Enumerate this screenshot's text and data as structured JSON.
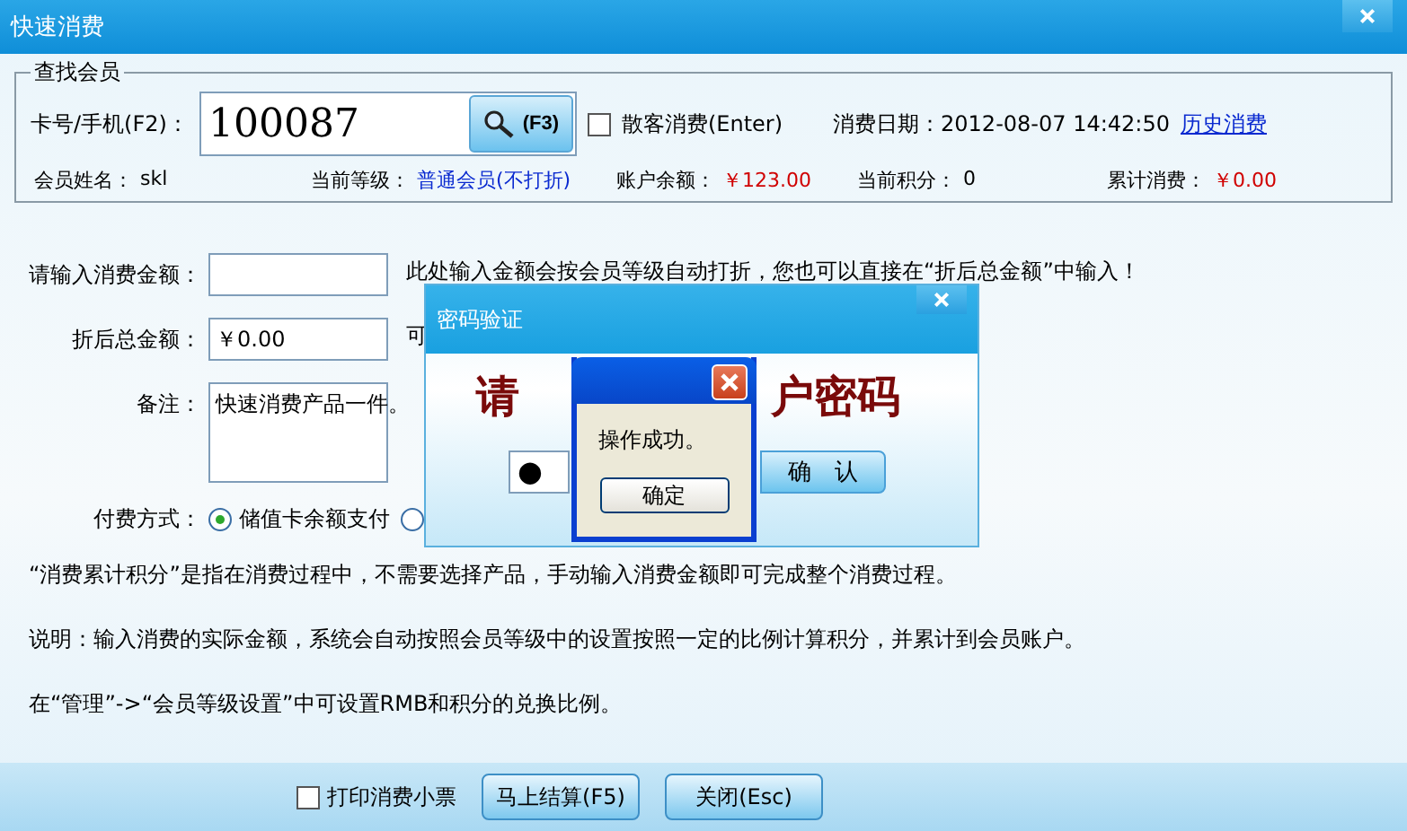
{
  "window": {
    "title": "快速消费"
  },
  "member_search": {
    "legend": "查找会员",
    "card_label": "卡号/手机(F2)：",
    "card_value": "100087",
    "search_button": "(F3)",
    "walk_in": {
      "label": "散客消费(Enter)",
      "checked": false
    },
    "date_label": "消费日期：",
    "date_value": "2012-08-07 14:42:50",
    "history_link": "历史消费",
    "info": [
      {
        "label": "会员姓名：",
        "value": "skl",
        "kind": "plain"
      },
      {
        "label": "当前等级：",
        "value": "普通会员(不打折)",
        "kind": "link"
      },
      {
        "label": "账户余额：",
        "value": "￥123.00",
        "kind": "money"
      },
      {
        "label": "当前积分：",
        "value": "0",
        "kind": "plain"
      },
      {
        "label": "累计消费：",
        "value": "￥0.00",
        "kind": "money"
      }
    ]
  },
  "form": {
    "amount": {
      "label": "请输入消费金额：",
      "hint": "此处输入金额会按会员等级自动打折，您也可以直接在“折后总金额”中输入！"
    },
    "total": {
      "label": "折后总金额：",
      "value": "￥0.00",
      "hint": "可"
    },
    "remark": {
      "label": "备注：",
      "value": "快速消费产品一件。"
    },
    "payment": {
      "label": "付费方式：",
      "options": [
        {
          "label": "储值卡余额支付",
          "selected": true
        },
        {
          "selected": false
        }
      ]
    }
  },
  "notes": [
    "“消费累计积分”是指在消费过程中，不需要选择产品，手动输入消费金额即可完成整个消费过程。",
    "说明：输入消费的实际金额，系统会自动按照会员等级中的设置按照一定的比例计算积分，并累计到会员账户。",
    "在“管理”->“会员等级设置”中可设置RMB和积分的兑换比例。"
  ],
  "footer": {
    "print_receipt": {
      "label": "打印消费小票",
      "checked": false
    },
    "buttons": [
      "马上结算(F5)",
      "关闭(Esc)"
    ]
  },
  "password_dialog": {
    "title": "密码验证",
    "prompt_parts": [
      "请",
      "户密码"
    ],
    "password_mask": "●",
    "confirm_button": "确　认"
  },
  "message_box": {
    "message": "操作成功。",
    "ok_button": "确定"
  }
}
